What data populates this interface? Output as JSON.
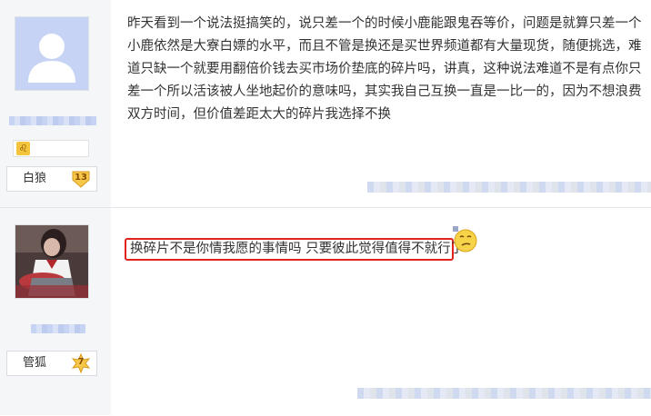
{
  "posts": [
    {
      "level_label": "白狼",
      "level_number": "13",
      "content": "昨天看到一个说法挺搞笑的，说只差一个的时候小鹿能跟鬼吞等价，问题是就算只差一个小鹿依然是大寮白嫖的水平，而且不管是换还是买世界频道都有大量现货，随便挑选，难道只缺一个就要用翻倍价钱去买市场价垫底的碎片吗，讲真，这种说法难道不是有点你只差一个所以活该被人坐地起价的意味吗，其实我自己互换一直是一比一的，因为不想浪费双方时间，但价值差距太大的碎片我选择不换",
      "zodiac_icon": "leo-icon"
    },
    {
      "level_label": "管狐",
      "level_number": "7",
      "content": "换碎片不是你情我愿的事情吗 只要彼此觉得值得不就行了",
      "highlight_color": "#e0231b"
    }
  ],
  "colors": {
    "sidebar_bg": "#f4f6f8",
    "badge_gold": "#f6c84a",
    "highlight_red": "#e0231b"
  }
}
